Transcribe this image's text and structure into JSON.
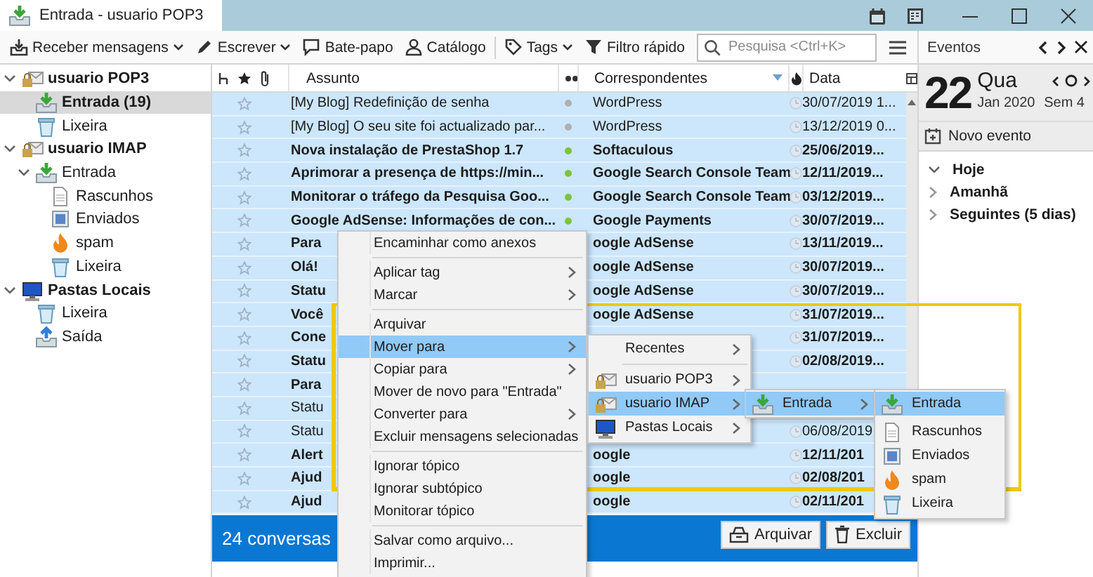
{
  "window": {
    "tab_title": "Entrada - usuario POP3"
  },
  "toolbar": {
    "buttons": [
      {
        "kind": "get",
        "label": "Receber mensagens",
        "dropdown": true
      },
      {
        "kind": "write",
        "label": "Escrever",
        "dropdown": true
      },
      {
        "kind": "chat",
        "label": "Bate-papo",
        "dropdown": false
      },
      {
        "kind": "contacts",
        "label": "Catálogo",
        "dropdown": false
      },
      {
        "kind": "tags",
        "label": "Tags",
        "dropdown": true
      },
      {
        "kind": "filter",
        "label": "Filtro rápido",
        "dropdown": false
      }
    ],
    "search": {
      "placeholder": "Pesquisa <Ctrl+K>"
    }
  },
  "folders": [
    {
      "label": "usuario POP3",
      "kind": "account",
      "expanded": true,
      "selected": false,
      "children": [
        {
          "label": "Entrada (19)",
          "kind": "inbox",
          "selected": true,
          "unread": true
        },
        {
          "label": "Lixeira",
          "kind": "trash",
          "selected": false,
          "unread": false
        }
      ]
    },
    {
      "label": "usuario IMAP",
      "kind": "account",
      "expanded": true,
      "selected": false,
      "children": [
        {
          "label": "Entrada",
          "kind": "inbox",
          "expanded": true,
          "selected": false,
          "unread": false,
          "children": [
            {
              "label": "Rascunhos",
              "kind": "drafts",
              "selected": false,
              "unread": false
            },
            {
              "label": "Enviados",
              "kind": "sent",
              "selected": false,
              "unread": false
            },
            {
              "label": "spam",
              "kind": "spam",
              "selected": false,
              "unread": false
            },
            {
              "label": "Lixeira",
              "kind": "trash",
              "selected": false,
              "unread": false
            }
          ]
        }
      ]
    },
    {
      "label": "Pastas Locais",
      "kind": "local",
      "expanded": true,
      "selected": false,
      "children": [
        {
          "label": "Lixeira",
          "kind": "trash",
          "selected": false,
          "unread": false
        },
        {
          "label": "Saída",
          "kind": "outbox",
          "selected": false,
          "unread": false
        }
      ]
    }
  ],
  "message_list": {
    "columns": {
      "subject": "Assunto",
      "correspondents": "Correspondentes",
      "date": "Data"
    },
    "rows": [
      {
        "subject": "[My Blog] Redefinição de senha",
        "correspondent": "WordPress",
        "date": "30/07/2019 1...",
        "color": "#b0b0b0",
        "selected": true,
        "unread": false
      },
      {
        "subject": "[My Blog] O seu site foi actualizado par...",
        "correspondent": "WordPress",
        "date": "13/12/2019 0...",
        "color": "#b0b0b0",
        "selected": true,
        "unread": false
      },
      {
        "subject": "Nova instalação de PrestaShop 1.7",
        "correspondent": "Softaculous",
        "date": "25/06/2019...",
        "color": "#7cc43a",
        "selected": true,
        "unread": true
      },
      {
        "subject": "Aprimorar a presença de https://min...",
        "correspondent": "Google Search Console Team",
        "date": "12/11/2019...",
        "color": "#7cc43a",
        "selected": true,
        "unread": true
      },
      {
        "subject": "Monitorar o tráfego da Pesquisa Goo...",
        "correspondent": "Google Search Console Team",
        "date": "03/12/2019...",
        "color": "#7cc43a",
        "selected": true,
        "unread": true
      },
      {
        "subject": "Google AdSense: Informações de con...",
        "correspondent": "Google Payments",
        "date": "30/07/2019...",
        "color": "#7cc43a",
        "selected": true,
        "unread": true
      },
      {
        "subject": "Para",
        "correspondent": "oogle AdSense",
        "date": "13/11/2019...",
        "selected": true,
        "unread": true
      },
      {
        "subject": "Olá!",
        "correspondent": "oogle AdSense",
        "date": "30/07/2019...",
        "selected": true,
        "unread": true
      },
      {
        "subject": "Statu",
        "correspondent": "oogle AdSense",
        "date": "30/07/2019...",
        "selected": true,
        "unread": true
      },
      {
        "subject": "Você",
        "correspondent": "oogle AdSense",
        "date": "31/07/2019...",
        "selected": true,
        "unread": true
      },
      {
        "subject": "Cone",
        "date": "31/07/2019...",
        "selected": true,
        "unread": true
      },
      {
        "subject": "Statu",
        "date": "02/08/2019...",
        "selected": true,
        "unread": true
      },
      {
        "subject": "Para",
        "selected": true,
        "unread": true
      },
      {
        "subject": "Statu",
        "selected": true,
        "unread": false
      },
      {
        "subject": "Statu",
        "date": "06/08/2019",
        "selected": true,
        "unread": false
      },
      {
        "subject": "Alert",
        "correspondent": "oogle",
        "date": "12/11/201",
        "selected": true,
        "unread": true
      },
      {
        "subject": "Ajud",
        "correspondent": "oogle",
        "date": "02/08/201",
        "selected": true,
        "unread": true
      },
      {
        "subject": "Ajud",
        "correspondent": "oogle",
        "date": "02/11/201",
        "selected": true,
        "unread": true
      }
    ],
    "footer": {
      "summary": "24 conversas",
      "buttons": [
        {
          "kind": "archive",
          "label": "Arquivar"
        },
        {
          "kind": "delete",
          "label": "Excluir"
        }
      ]
    }
  },
  "events": {
    "title": "Eventos",
    "day": "22",
    "weekday": "Qua",
    "month": "Jan 2020",
    "week": "Sem 4",
    "new_event": "Novo evento",
    "sections": [
      {
        "label": "Hoje",
        "expanded": true
      },
      {
        "label": "Amanhã",
        "expanded": false
      },
      {
        "label": "Seguintes (5 dias)",
        "expanded": false
      }
    ]
  },
  "context_menu": {
    "items": [
      {
        "kind": "command",
        "label": "Encaminhar como anexos",
        "submenu": false,
        "selected": false
      },
      {
        "kind": "separator"
      },
      {
        "kind": "command",
        "label": "Aplicar tag",
        "submenu": true,
        "selected": false
      },
      {
        "kind": "command",
        "label": "Marcar",
        "submenu": true,
        "selected": false
      },
      {
        "kind": "separator"
      },
      {
        "kind": "command",
        "label": "Arquivar",
        "submenu": false,
        "selected": false
      },
      {
        "kind": "command",
        "label": "Mover para",
        "submenu": true,
        "selected": true
      },
      {
        "kind": "command",
        "label": "Copiar para",
        "submenu": true,
        "selected": false
      },
      {
        "kind": "command",
        "label": "Mover de novo para \"Entrada\"",
        "submenu": false,
        "selected": false
      },
      {
        "kind": "command",
        "label": "Converter para",
        "submenu": true,
        "selected": false
      },
      {
        "kind": "command",
        "label": "Excluir mensagens selecionadas",
        "submenu": false,
        "selected": false
      },
      {
        "kind": "separator"
      },
      {
        "kind": "command",
        "label": "Ignorar tópico",
        "submenu": false,
        "selected": false
      },
      {
        "kind": "command",
        "label": "Ignorar subtópico",
        "submenu": false,
        "selected": false
      },
      {
        "kind": "command",
        "label": "Monitorar tópico",
        "submenu": false,
        "selected": false
      },
      {
        "kind": "separator"
      },
      {
        "kind": "command",
        "label": "Salvar como arquivo...",
        "submenu": false,
        "selected": false
      },
      {
        "kind": "command",
        "label": "Imprimir...",
        "submenu": false,
        "selected": false
      }
    ]
  },
  "move_submenu": {
    "items": [
      {
        "kind": "recent",
        "label": "Recentes",
        "submenu": true,
        "selected": false
      },
      {
        "kind": "separator"
      },
      {
        "kind": "account",
        "label": "usuario POP3",
        "submenu": true,
        "selected": false
      },
      {
        "kind": "account",
        "label": "usuario IMAP",
        "submenu": true,
        "selected": true
      },
      {
        "kind": "local",
        "label": "Pastas Locais",
        "submenu": true,
        "selected": false
      }
    ]
  },
  "account_submenu": {
    "items": [
      {
        "kind": "inbox",
        "label": "Entrada",
        "submenu": true,
        "selected": true
      }
    ]
  },
  "folder_submenu": {
    "items": [
      {
        "kind": "inbox",
        "label": "Entrada",
        "submenu": false,
        "selected": true
      },
      {
        "kind": "gap"
      },
      {
        "kind": "drafts",
        "label": "Rascunhos",
        "submenu": false,
        "selected": false
      },
      {
        "kind": "sent",
        "label": "Enviados",
        "submenu": false,
        "selected": false
      },
      {
        "kind": "spam",
        "label": "spam",
        "submenu": false,
        "selected": false
      },
      {
        "kind": "trash",
        "label": "Lixeira",
        "submenu": false,
        "selected": false
      }
    ]
  }
}
